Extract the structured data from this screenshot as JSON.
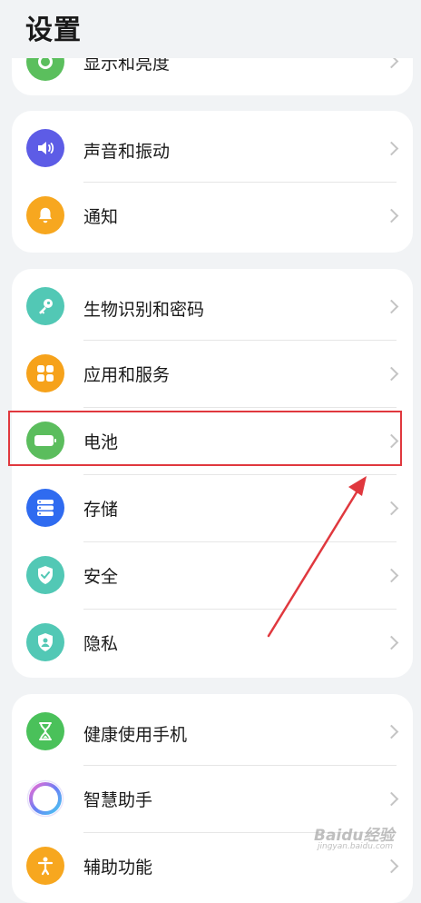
{
  "header": {
    "title": "设置"
  },
  "partial_item": {
    "label": "显示和亮度",
    "icon": "display-icon",
    "color": "#5bbf5d"
  },
  "groups": [
    {
      "items": [
        {
          "label": "声音和振动",
          "icon": "speaker-icon",
          "color": "#5d5ce6"
        },
        {
          "label": "通知",
          "icon": "bell-icon",
          "color": "#f7a71f"
        }
      ]
    },
    {
      "items": [
        {
          "label": "生物识别和密码",
          "icon": "key-icon",
          "color": "#52c8b5"
        },
        {
          "label": "应用和服务",
          "icon": "apps-grid-icon",
          "color": "#f6a21b"
        },
        {
          "label": "电池",
          "icon": "battery-icon",
          "color": "#5bbd5d"
        },
        {
          "label": "存储",
          "icon": "storage-icon",
          "color": "#2f6bf0"
        },
        {
          "label": "安全",
          "icon": "shield-check-icon",
          "color": "#52c8b5"
        },
        {
          "label": "隐私",
          "icon": "privacy-shield-icon",
          "color": "#52c8b5"
        }
      ]
    },
    {
      "items": [
        {
          "label": "健康使用手机",
          "icon": "hourglass-icon",
          "color": "#4ac15a"
        },
        {
          "label": "智慧助手",
          "icon": "assistant-ring-icon",
          "color": "#8f6df2"
        },
        {
          "label": "辅助功能",
          "icon": "accessibility-icon",
          "color": "#f7a71f"
        }
      ]
    }
  ],
  "annotation": {
    "highlight_color": "#e0383e"
  },
  "watermark": {
    "logo": "Baidu经验",
    "url": "jingyan.baidu.com"
  }
}
